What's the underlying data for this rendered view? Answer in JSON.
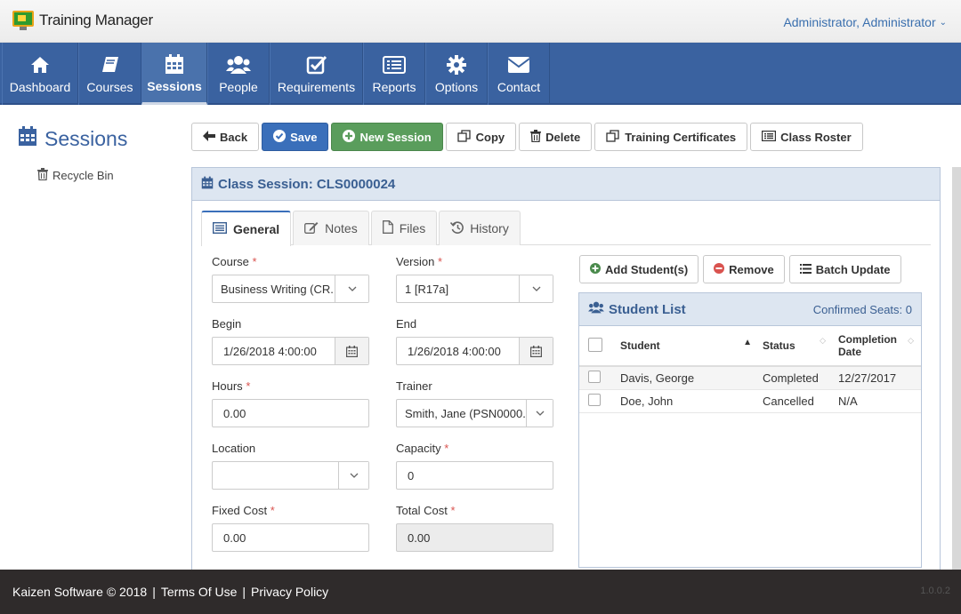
{
  "app": {
    "title": "Training Manager",
    "user": "Administrator, Administrator"
  },
  "nav": [
    {
      "label": "Dashboard",
      "icon": "home-icon"
    },
    {
      "label": "Courses",
      "icon": "book-icon"
    },
    {
      "label": "Sessions",
      "icon": "calendar-icon",
      "active": true
    },
    {
      "label": "People",
      "icon": "users-icon"
    },
    {
      "label": "Requirements",
      "icon": "check-square-icon"
    },
    {
      "label": "Reports",
      "icon": "list-icon"
    },
    {
      "label": "Options",
      "icon": "gear-icon"
    },
    {
      "label": "Contact",
      "icon": "envelope-icon"
    }
  ],
  "sidebar": {
    "title": "Sessions",
    "recycle_bin": "Recycle Bin"
  },
  "toolbar": {
    "back": "Back",
    "save": "Save",
    "new_session": "New Session",
    "copy": "Copy",
    "delete": "Delete",
    "training_certificates": "Training Certificates",
    "class_roster": "Class Roster"
  },
  "panel": {
    "title": "Class Session: CLS0000024"
  },
  "tabs": [
    {
      "label": "General",
      "active": true
    },
    {
      "label": "Notes"
    },
    {
      "label": "Files"
    },
    {
      "label": "History"
    }
  ],
  "form": {
    "course": {
      "label": "Course",
      "value": "Business Writing (CR..."
    },
    "version": {
      "label": "Version",
      "value": "1 [R17a]"
    },
    "begin": {
      "label": "Begin",
      "value": "1/26/2018 4:00:00"
    },
    "end": {
      "label": "End",
      "value": "1/26/2018 4:00:00"
    },
    "hours": {
      "label": "Hours",
      "value": "0.00"
    },
    "trainer": {
      "label": "Trainer",
      "value": "Smith, Jane (PSN0000..."
    },
    "location": {
      "label": "Location",
      "value": ""
    },
    "capacity": {
      "label": "Capacity",
      "value": "0"
    },
    "fixed_cost": {
      "label": "Fixed Cost",
      "value": "0.00"
    },
    "total_cost": {
      "label": "Total Cost",
      "value": "0.00"
    },
    "required_marker": "*"
  },
  "students": {
    "add": "Add Student(s)",
    "remove": "Remove",
    "batch_update": "Batch Update",
    "title": "Student List",
    "confirmed": "Confirmed Seats: 0",
    "columns": {
      "student": "Student",
      "status": "Status",
      "completion_line1": "Completion",
      "completion_line2": "Date"
    },
    "rows": [
      {
        "student": "Davis, George",
        "status": "Completed",
        "date": "12/27/2017"
      },
      {
        "student": "Doe, John",
        "status": "Cancelled",
        "date": "N/A"
      }
    ]
  },
  "footer": {
    "copyright": "Kaizen Software © 2018",
    "terms": "Terms Of Use",
    "privacy": "Privacy Policy",
    "version": "1.0.0.2"
  },
  "colors": {
    "nav": "#3a62a0",
    "accent": "#3a6fba",
    "success": "#5a9d5c",
    "required": "#d9534f",
    "footer": "#2f2b2b"
  }
}
